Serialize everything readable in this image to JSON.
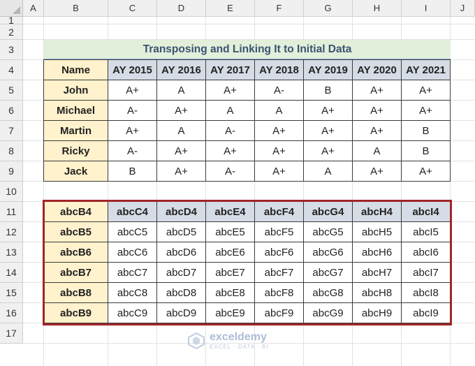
{
  "sheet": {
    "columns": [
      "A",
      "B",
      "C",
      "D",
      "E",
      "F",
      "G",
      "H",
      "I",
      "J"
    ],
    "rows": [
      "1",
      "2",
      "3",
      "4",
      "5",
      "6",
      "7",
      "8",
      "9",
      "10",
      "11",
      "12",
      "13",
      "14",
      "15",
      "16",
      "17"
    ]
  },
  "title": "Transposing and Linking It to Initial Data",
  "table1": {
    "header": [
      "Name",
      "AY 2015",
      "AY 2016",
      "AY 2017",
      "AY 2018",
      "AY 2019",
      "AY 2020",
      "AY 2021"
    ],
    "rows": [
      [
        "John",
        "A+",
        "A",
        "A+",
        "A-",
        "B",
        "A+",
        "A+"
      ],
      [
        "Michael",
        "A-",
        "A+",
        "A",
        "A",
        "A+",
        "A+",
        "A+"
      ],
      [
        "Martin",
        "A+",
        "A",
        "A-",
        "A+",
        "A+",
        "A+",
        "B"
      ],
      [
        "Ricky",
        "A-",
        "A+",
        "A+",
        "A+",
        "A+",
        "A",
        "B"
      ],
      [
        "Jack",
        "B",
        "A+",
        "A-",
        "A+",
        "A",
        "A+",
        "A+"
      ]
    ]
  },
  "table2": {
    "header": [
      "abcB4",
      "abcC4",
      "abcD4",
      "abcE4",
      "abcF4",
      "abcG4",
      "abcH4",
      "abcI4"
    ],
    "rows": [
      [
        "abcB5",
        "abcC5",
        "abcD5",
        "abcE5",
        "abcF5",
        "abcG5",
        "abcH5",
        "abcI5"
      ],
      [
        "abcB6",
        "abcC6",
        "abcD6",
        "abcE6",
        "abcF6",
        "abcG6",
        "abcH6",
        "abcI6"
      ],
      [
        "abcB7",
        "abcC7",
        "abcD7",
        "abcE7",
        "abcF7",
        "abcG7",
        "abcH7",
        "abcI7"
      ],
      [
        "abcB8",
        "abcC8",
        "abcD8",
        "abcE8",
        "abcF8",
        "abcG8",
        "abcH8",
        "abcI8"
      ],
      [
        "abcB9",
        "abcC9",
        "abcD9",
        "abcE9",
        "abcF9",
        "abcG9",
        "abcH9",
        "abcI9"
      ]
    ]
  },
  "watermark": {
    "brand": "exceldemy",
    "tagline": "EXCEL · DATA · BI"
  },
  "colors": {
    "title_fill": "#e2efda",
    "title_text": "#3a5372",
    "header_yellow": "#fff2cc",
    "header_gray": "#d6dce5",
    "frame_red": "#a0252a"
  }
}
